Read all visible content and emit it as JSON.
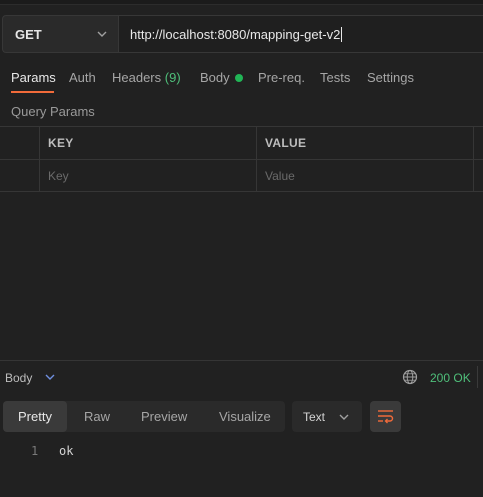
{
  "request": {
    "method": "GET",
    "url": "http://localhost:8080/mapping-get-v2"
  },
  "tabs": [
    {
      "label": "Params",
      "active": true
    },
    {
      "label": "Auth"
    },
    {
      "label": "Headers",
      "count": "(9)"
    },
    {
      "label": "Body",
      "indicator": "green-dot"
    },
    {
      "label": "Pre-req."
    },
    {
      "label": "Tests"
    },
    {
      "label": "Settings"
    }
  ],
  "params": {
    "section_title": "Query Params",
    "columns": {
      "key": "KEY",
      "value": "VALUE"
    },
    "placeholders": {
      "key": "Key",
      "value": "Value"
    }
  },
  "response": {
    "label": "Body",
    "status": "200 OK",
    "view_tabs": [
      "Pretty",
      "Raw",
      "Preview",
      "Visualize"
    ],
    "active_view": "Pretty",
    "format": "Text",
    "lines": [
      {
        "num": "1",
        "text": "ok"
      }
    ]
  },
  "colors": {
    "accent": "#f26b3a",
    "success": "#4fbf7a",
    "background": "#212121"
  }
}
